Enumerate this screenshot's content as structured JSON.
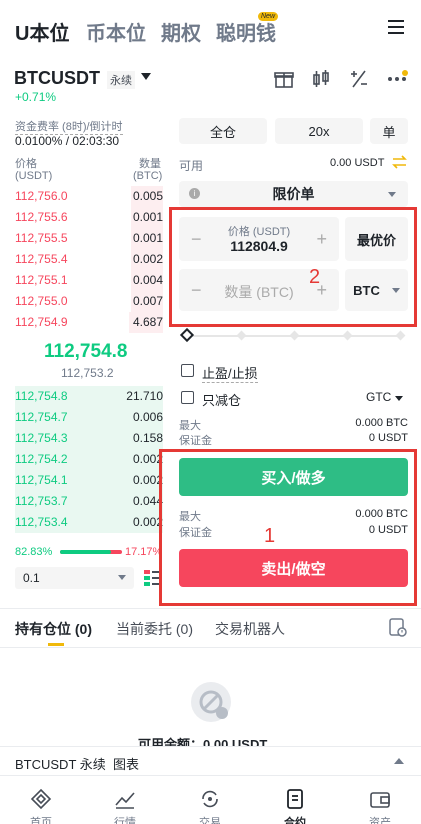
{
  "top_tabs": [
    "U本位",
    "币本位",
    "期权",
    "聪明钱"
  ],
  "new_badge": "New",
  "symbol": "BTCUSDT",
  "perp_badge": "永续",
  "change": "+0.71%",
  "funding_label": "资金费率 (8时)/倒计时",
  "funding_value": "0.0100% / 02:03:30",
  "ob_header": {
    "price": "价格",
    "price_unit": "(USDT)",
    "qty": "数量",
    "qty_unit": "(BTC)"
  },
  "asks": [
    {
      "price": "112,756.0",
      "qty": "0.005"
    },
    {
      "price": "112,755.6",
      "qty": "0.001"
    },
    {
      "price": "112,755.5",
      "qty": "0.001"
    },
    {
      "price": "112,755.4",
      "qty": "0.002"
    },
    {
      "price": "112,755.1",
      "qty": "0.004"
    },
    {
      "price": "112,755.0",
      "qty": "0.007"
    },
    {
      "price": "112,754.9",
      "qty": "4.687"
    }
  ],
  "last_price": "112,754.8",
  "mark_price": "112,753.2",
  "bids": [
    {
      "price": "112,754.8",
      "qty": "21.710"
    },
    {
      "price": "112,754.7",
      "qty": "0.006"
    },
    {
      "price": "112,754.3",
      "qty": "0.158"
    },
    {
      "price": "112,754.2",
      "qty": "0.002"
    },
    {
      "price": "112,754.1",
      "qty": "0.002"
    },
    {
      "price": "112,753.7",
      "qty": "0.044"
    },
    {
      "price": "112,753.4",
      "qty": "0.002"
    }
  ],
  "ratio": {
    "buy": "82.83%",
    "sell": "17.17%",
    "buy_fraction": 0.8283
  },
  "depth_select": "0.1",
  "margin_mode": "全仓",
  "leverage": "20x",
  "position_mode": "单",
  "available_label": "可用",
  "available_value": "0.00 USDT",
  "order_type": "限价单",
  "price_input": {
    "label": "价格 (USDT)",
    "value": "112804.9"
  },
  "best_price": "最优价",
  "qty_placeholder": "数量 (BTC)",
  "qty_unit": "BTC",
  "tp_sl": "止盈/止损",
  "reduce_only": "只减仓",
  "tif": "GTC",
  "max_label": "最大",
  "max_value": "0.000 BTC",
  "margin_label": "保证金",
  "margin_value": "0 USDT",
  "buy_button": "买入/做多",
  "sell_button": "卖出/做空",
  "annotations": {
    "one": "1",
    "two": "2"
  },
  "positions_tabs": [
    "持有仓位 (0)",
    "当前委托 (0)",
    "交易机器人"
  ],
  "available_balance": "可用余额：0.00 USDT",
  "chart_bar": {
    "label": "BTCUSDT 永续  图表"
  },
  "nav": [
    "首页",
    "行情",
    "交易",
    "合约",
    "资产"
  ]
}
